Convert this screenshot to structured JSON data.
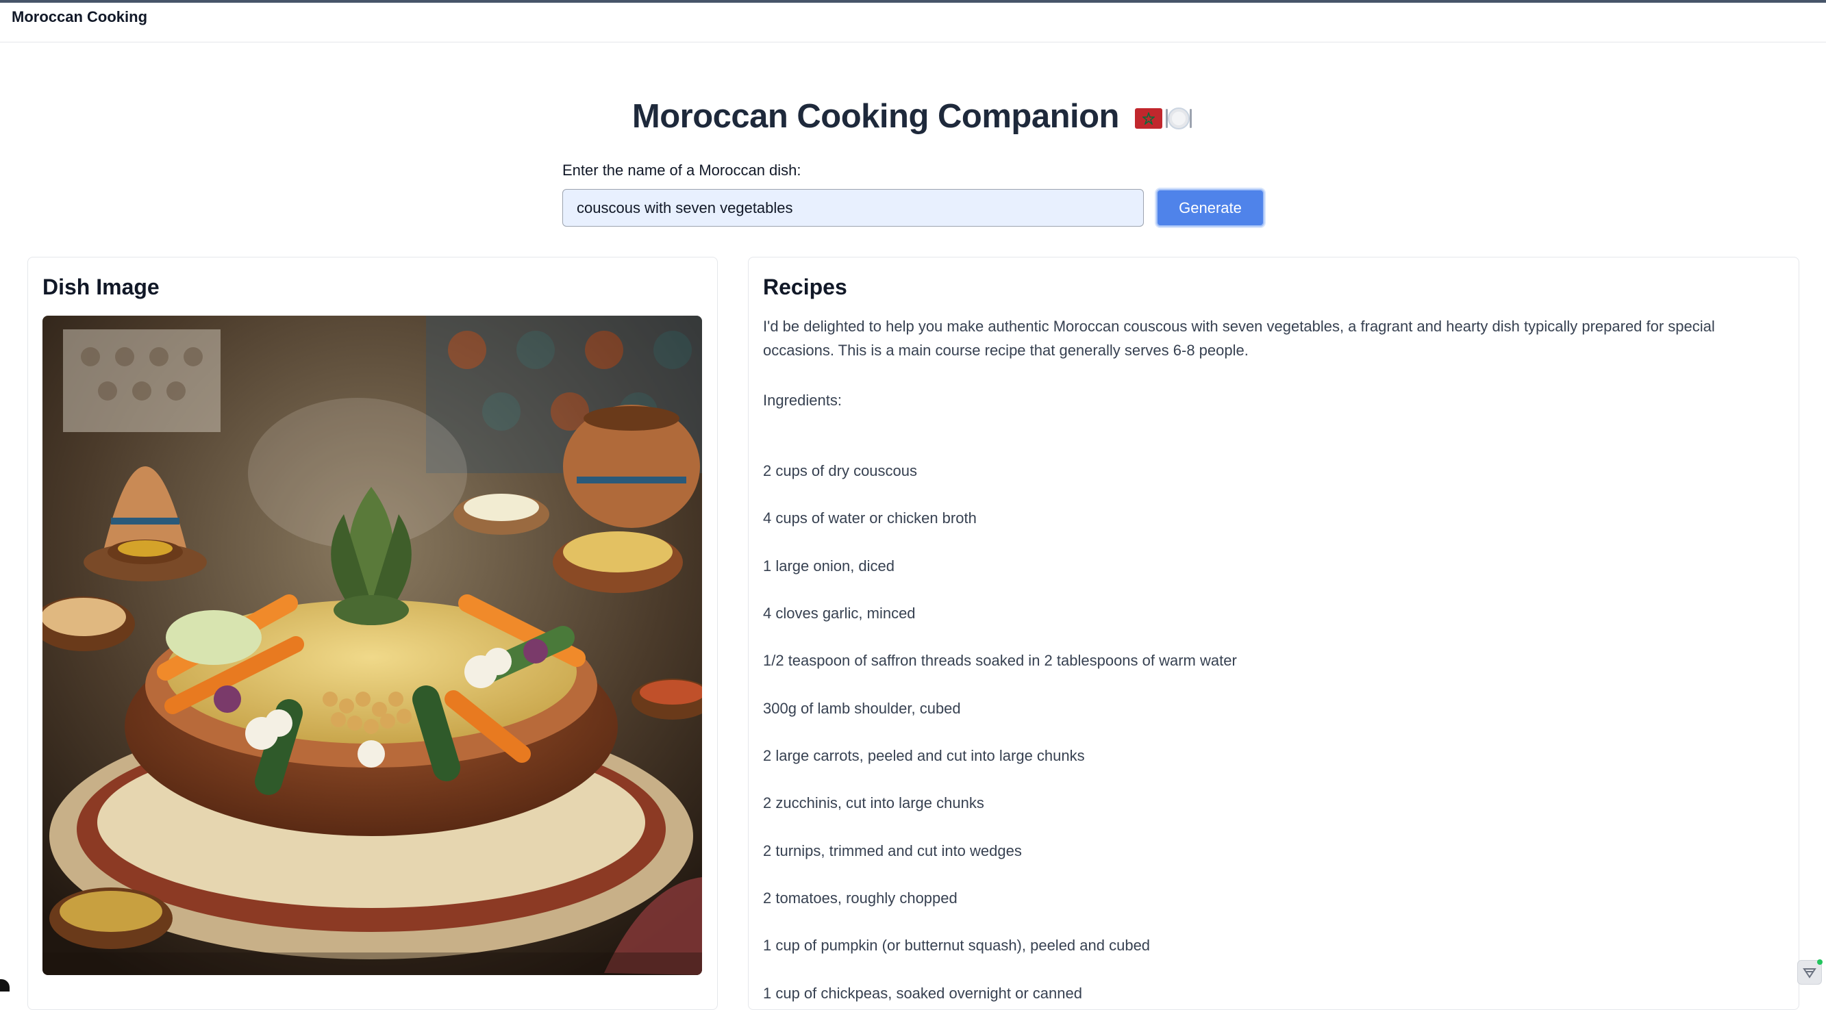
{
  "app": {
    "title": "Moroccan Cooking"
  },
  "page": {
    "heading": "Moroccan Cooking Companion"
  },
  "search": {
    "label": "Enter the name of a Moroccan dish:",
    "value": "couscous with seven vegetables",
    "button_label": "Generate"
  },
  "image_panel": {
    "title": "Dish Image"
  },
  "recipes_panel": {
    "title": "Recipes",
    "intro": "I'd be delighted to help you make authentic Moroccan couscous with seven vegetables, a fragrant and hearty dish typically prepared for special occasions. This is a main course recipe that generally serves 6-8 people.",
    "ingredients_heading": "Ingredients:",
    "ingredients": [
      "2 cups of dry couscous",
      "4 cups of water or chicken broth",
      "1 large onion, diced",
      "4 cloves garlic, minced",
      "1/2 teaspoon of saffron threads soaked in 2 tablespoons of warm water",
      "300g of lamb shoulder, cubed",
      "2 large carrots, peeled and cut into large chunks",
      "2 zucchinis, cut into large chunks",
      "2 turnips, trimmed and cut into wedges",
      "2 tomatoes, roughly chopped",
      "1 cup of pumpkin (or butternut squash), peeled and cubed",
      "1 cup of chickpeas, soaked overnight or canned"
    ]
  },
  "colors": {
    "accent": "#4f83ea",
    "input_bg": "#e8f0fe",
    "heading": "#1e293b"
  }
}
